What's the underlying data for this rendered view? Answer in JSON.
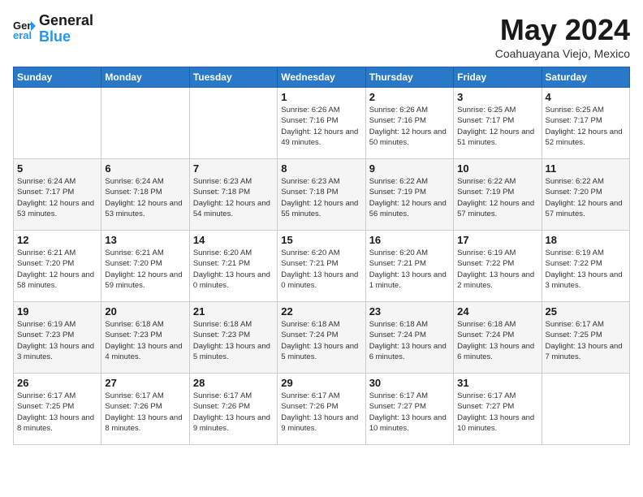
{
  "header": {
    "logo_line1": "General",
    "logo_line2": "Blue",
    "month": "May 2024",
    "location": "Coahuayana Viejo, Mexico"
  },
  "days_of_week": [
    "Sunday",
    "Monday",
    "Tuesday",
    "Wednesday",
    "Thursday",
    "Friday",
    "Saturday"
  ],
  "weeks": [
    [
      {
        "day": "",
        "info": ""
      },
      {
        "day": "",
        "info": ""
      },
      {
        "day": "",
        "info": ""
      },
      {
        "day": "1",
        "info": "Sunrise: 6:26 AM\nSunset: 7:16 PM\nDaylight: 12 hours\nand 49 minutes."
      },
      {
        "day": "2",
        "info": "Sunrise: 6:26 AM\nSunset: 7:16 PM\nDaylight: 12 hours\nand 50 minutes."
      },
      {
        "day": "3",
        "info": "Sunrise: 6:25 AM\nSunset: 7:17 PM\nDaylight: 12 hours\nand 51 minutes."
      },
      {
        "day": "4",
        "info": "Sunrise: 6:25 AM\nSunset: 7:17 PM\nDaylight: 12 hours\nand 52 minutes."
      }
    ],
    [
      {
        "day": "5",
        "info": "Sunrise: 6:24 AM\nSunset: 7:17 PM\nDaylight: 12 hours\nand 53 minutes."
      },
      {
        "day": "6",
        "info": "Sunrise: 6:24 AM\nSunset: 7:18 PM\nDaylight: 12 hours\nand 53 minutes."
      },
      {
        "day": "7",
        "info": "Sunrise: 6:23 AM\nSunset: 7:18 PM\nDaylight: 12 hours\nand 54 minutes."
      },
      {
        "day": "8",
        "info": "Sunrise: 6:23 AM\nSunset: 7:18 PM\nDaylight: 12 hours\nand 55 minutes."
      },
      {
        "day": "9",
        "info": "Sunrise: 6:22 AM\nSunset: 7:19 PM\nDaylight: 12 hours\nand 56 minutes."
      },
      {
        "day": "10",
        "info": "Sunrise: 6:22 AM\nSunset: 7:19 PM\nDaylight: 12 hours\nand 57 minutes."
      },
      {
        "day": "11",
        "info": "Sunrise: 6:22 AM\nSunset: 7:20 PM\nDaylight: 12 hours\nand 57 minutes."
      }
    ],
    [
      {
        "day": "12",
        "info": "Sunrise: 6:21 AM\nSunset: 7:20 PM\nDaylight: 12 hours\nand 58 minutes."
      },
      {
        "day": "13",
        "info": "Sunrise: 6:21 AM\nSunset: 7:20 PM\nDaylight: 12 hours\nand 59 minutes."
      },
      {
        "day": "14",
        "info": "Sunrise: 6:20 AM\nSunset: 7:21 PM\nDaylight: 13 hours\nand 0 minutes."
      },
      {
        "day": "15",
        "info": "Sunrise: 6:20 AM\nSunset: 7:21 PM\nDaylight: 13 hours\nand 0 minutes."
      },
      {
        "day": "16",
        "info": "Sunrise: 6:20 AM\nSunset: 7:21 PM\nDaylight: 13 hours\nand 1 minute."
      },
      {
        "day": "17",
        "info": "Sunrise: 6:19 AM\nSunset: 7:22 PM\nDaylight: 13 hours\nand 2 minutes."
      },
      {
        "day": "18",
        "info": "Sunrise: 6:19 AM\nSunset: 7:22 PM\nDaylight: 13 hours\nand 3 minutes."
      }
    ],
    [
      {
        "day": "19",
        "info": "Sunrise: 6:19 AM\nSunset: 7:23 PM\nDaylight: 13 hours\nand 3 minutes."
      },
      {
        "day": "20",
        "info": "Sunrise: 6:18 AM\nSunset: 7:23 PM\nDaylight: 13 hours\nand 4 minutes."
      },
      {
        "day": "21",
        "info": "Sunrise: 6:18 AM\nSunset: 7:23 PM\nDaylight: 13 hours\nand 5 minutes."
      },
      {
        "day": "22",
        "info": "Sunrise: 6:18 AM\nSunset: 7:24 PM\nDaylight: 13 hours\nand 5 minutes."
      },
      {
        "day": "23",
        "info": "Sunrise: 6:18 AM\nSunset: 7:24 PM\nDaylight: 13 hours\nand 6 minutes."
      },
      {
        "day": "24",
        "info": "Sunrise: 6:18 AM\nSunset: 7:24 PM\nDaylight: 13 hours\nand 6 minutes."
      },
      {
        "day": "25",
        "info": "Sunrise: 6:17 AM\nSunset: 7:25 PM\nDaylight: 13 hours\nand 7 minutes."
      }
    ],
    [
      {
        "day": "26",
        "info": "Sunrise: 6:17 AM\nSunset: 7:25 PM\nDaylight: 13 hours\nand 8 minutes."
      },
      {
        "day": "27",
        "info": "Sunrise: 6:17 AM\nSunset: 7:26 PM\nDaylight: 13 hours\nand 8 minutes."
      },
      {
        "day": "28",
        "info": "Sunrise: 6:17 AM\nSunset: 7:26 PM\nDaylight: 13 hours\nand 9 minutes."
      },
      {
        "day": "29",
        "info": "Sunrise: 6:17 AM\nSunset: 7:26 PM\nDaylight: 13 hours\nand 9 minutes."
      },
      {
        "day": "30",
        "info": "Sunrise: 6:17 AM\nSunset: 7:27 PM\nDaylight: 13 hours\nand 10 minutes."
      },
      {
        "day": "31",
        "info": "Sunrise: 6:17 AM\nSunset: 7:27 PM\nDaylight: 13 hours\nand 10 minutes."
      },
      {
        "day": "",
        "info": ""
      }
    ]
  ]
}
